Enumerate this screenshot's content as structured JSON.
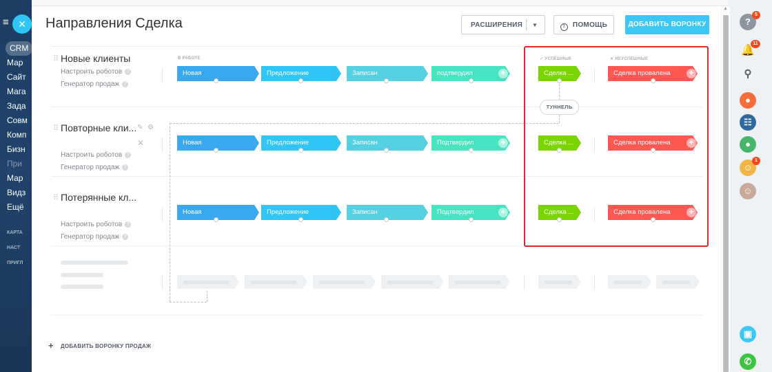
{
  "left_nav": {
    "items": [
      {
        "label": "CRM",
        "dim": false
      },
      {
        "label": "Мар",
        "dim": false
      },
      {
        "label": "Сайт",
        "dim": false
      },
      {
        "label": "Мага",
        "dim": false
      },
      {
        "label": "Зада",
        "dim": false
      },
      {
        "label": "Совм",
        "dim": false
      },
      {
        "label": "Комп",
        "dim": false
      },
      {
        "label": "Бизн",
        "dim": false
      },
      {
        "label": "При",
        "dim": true
      },
      {
        "label": "Мар",
        "dim": false
      },
      {
        "label": "Видз",
        "dim": false
      },
      {
        "label": "Ещё",
        "dim": false
      },
      {
        "label": "КАРТА",
        "dim": true
      },
      {
        "label": "НАСТ",
        "dim": true
      },
      {
        "label": "ПРИГЛ",
        "dim": true
      }
    ]
  },
  "header": {
    "title": "Направления Сделка",
    "extensions_label": "РАСШИРЕНИЯ",
    "help_label": "ПОМОЩЬ",
    "add_funnel_label": "ДОБАВИТЬ ВОРОНКУ"
  },
  "columns": {
    "in_work": "В РАБОТЕ",
    "success": "✓ УСПЕШНЫЕ",
    "failed": "✕ НЕУСПЕШНЫЕ"
  },
  "tunnel_label": "ТУННЕЛЬ",
  "funnels": [
    {
      "name": "Новые клиенты",
      "robots": "Настроить роботов",
      "generator": "Генератор продаж",
      "stages": [
        "Новая",
        "Предложение",
        "Записан",
        "подтвердил"
      ],
      "success": "Сделка ...",
      "failed": "Сделка провалена"
    },
    {
      "name": "Повторные кли...",
      "robots": "Настроить роботов",
      "generator": "Генератор продаж",
      "stages": [
        "Новая",
        "Предложение",
        "Записан",
        "Подтвердил"
      ],
      "success": "Сделка ...",
      "failed": "Сделка провалена"
    },
    {
      "name": "Потерянные кл...",
      "robots": "Настроить роботов",
      "generator": "Генератор продаж",
      "stages": [
        "Новая",
        "Предложение",
        "Записан",
        "Подтвердил"
      ],
      "success": "Сделка ...",
      "failed": "Сделка провалена"
    }
  ],
  "stage_colors": [
    "#39a8ef",
    "#2fc6f6",
    "#55d0e0",
    "#47e4c2"
  ],
  "success_color": "#7bd500",
  "failed_color": "#ff5752",
  "footer": {
    "add_sales_funnel": "ДОБАВИТЬ ВОРОНКУ ПРОДАЖ"
  },
  "right_bar": {
    "help_badge": "5",
    "notify_badge": "11",
    "avatar_badge": "1"
  }
}
